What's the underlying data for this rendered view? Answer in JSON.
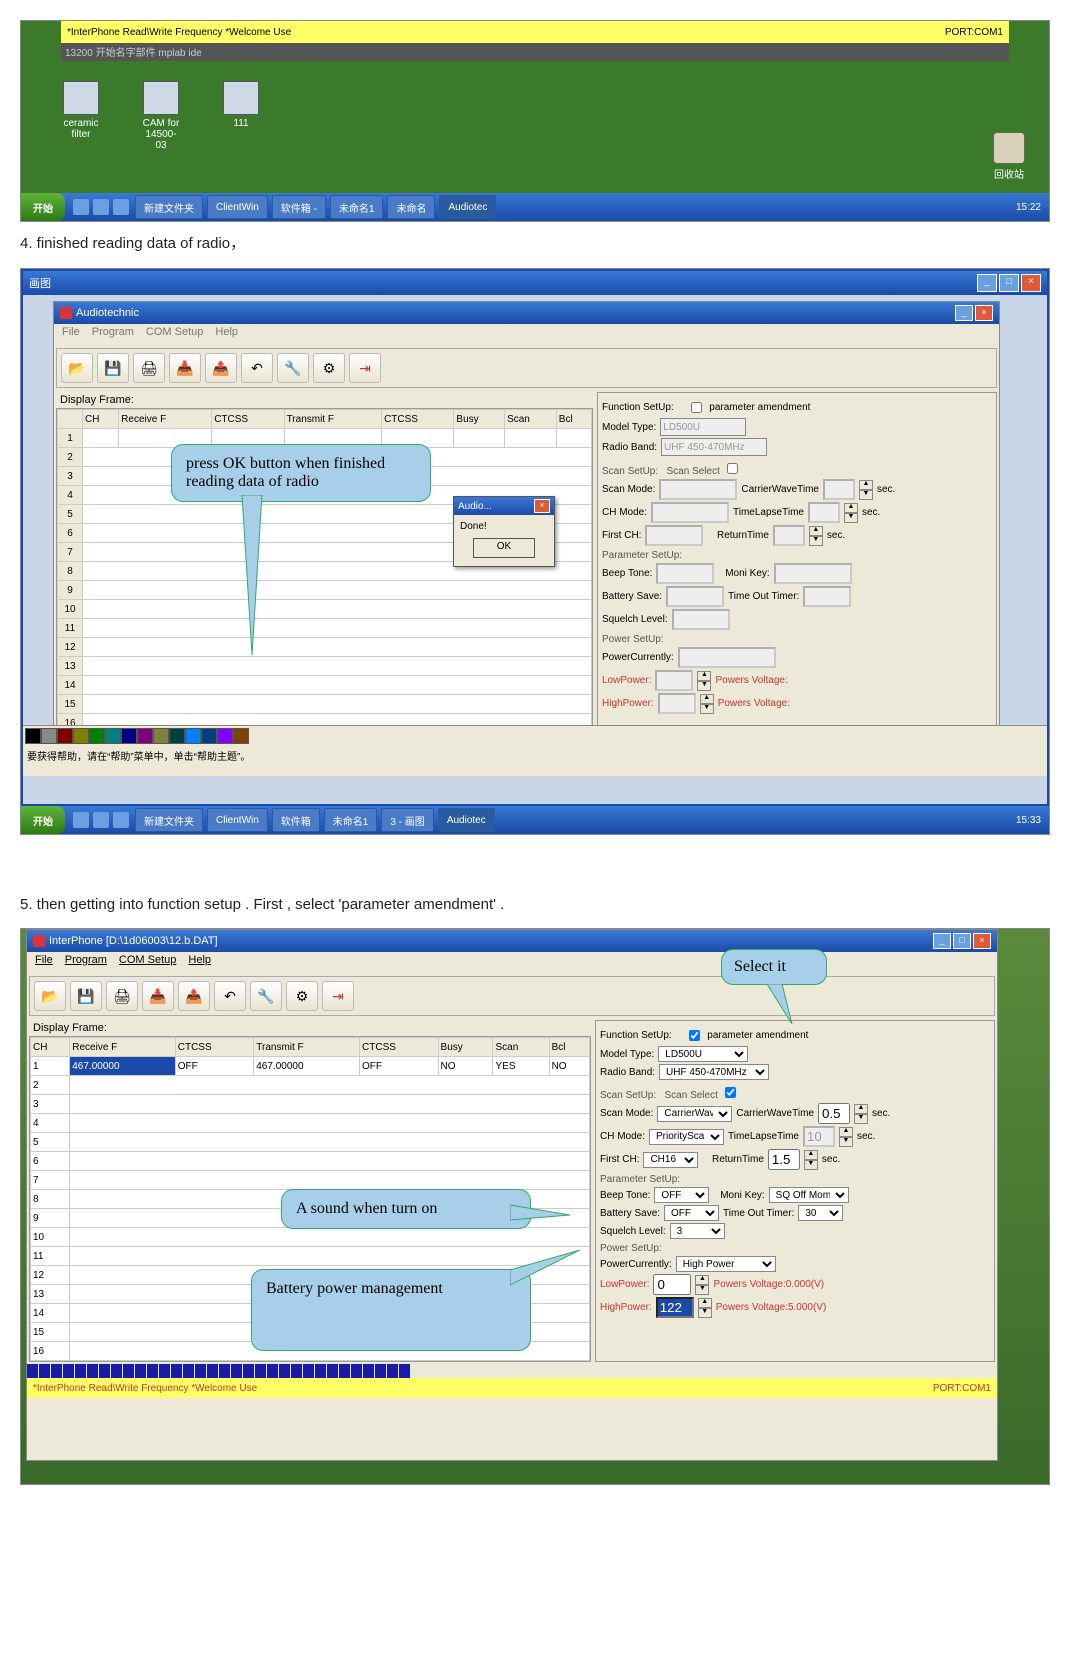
{
  "steps": {
    "s4": "4. finished  reading data of radio，",
    "s5": "5. then getting into function setup . First , select 'parameter amendment' ."
  },
  "callouts": {
    "c1": "press OK button when finished reading data of radio",
    "c2": "Select it",
    "c3": "A sound when turn on",
    "c4": "Battery power management"
  },
  "shot1": {
    "status_left": "*InterPhone Read\\Write Frequency  *Welcome Use",
    "status_right": "PORT:COM1",
    "grey": "13200   开始名字部件   mplab ide",
    "icons": [
      "ceramic filter",
      "CAM for 14500-03",
      "111"
    ],
    "trash": "回收站"
  },
  "taskbar": {
    "start": "开始",
    "items": [
      "新建文件夹",
      "ClientWin",
      "软件箱 -",
      "未命名1",
      "未命名",
      "Audiotec"
    ],
    "clock": "15:22"
  },
  "app": {
    "title": "Audiotechnic",
    "title3": "InterPhone  [D:\\1d06003\\12.b.DAT]",
    "menu": [
      "File",
      "Program",
      "COM Setup",
      "Help"
    ],
    "menu_grey": [
      "File",
      "Program",
      "COM Setup",
      "Help"
    ],
    "pane_label": "Display Frame:",
    "cols": [
      "CH",
      "Receive F",
      "CTCSS",
      "Transmit F",
      "CTCSS",
      "Busy",
      "Scan",
      "Bcl"
    ],
    "rows": [
      "1",
      "2",
      "3",
      "4",
      "5",
      "6",
      "7",
      "8",
      "9",
      "10",
      "11",
      "12",
      "13",
      "14",
      "15",
      "16"
    ],
    "s3_row1": [
      "1",
      "467.00000",
      "OFF",
      "467.00000",
      "OFF",
      "NO",
      "YES",
      "NO"
    ],
    "fn_label": "Function SetUp:",
    "param_amend": "parameter amendment",
    "model_type_lbl": "Model Type:",
    "model_type_val": "LD500U",
    "radio_band_lbl": "Radio Band:",
    "radio_band_val": "UHF 450-470MHz",
    "scan_setup": "Scan SetUp:",
    "scan_select": "Scan Select",
    "scan_mode_lbl": "Scan Mode:",
    "scan_mode_val": "CarrierWave",
    "carrier_time_lbl": "CarrierWaveTime",
    "carrier_time_val": "0.5",
    "ch_mode_lbl": "CH Mode:",
    "ch_mode_val": "PriorityScant",
    "timelapse_lbl": "TimeLapseTime",
    "timelapse_val": "10",
    "first_ch_lbl": "First CH:",
    "first_ch_val": "CH16",
    "return_lbl": "ReturnTime",
    "return_val": "1.5",
    "sec_unit": "sec.",
    "param_setup": "Parameter SetUp:",
    "beep_lbl": "Beep Tone:",
    "beep_val": "OFF",
    "moni_lbl": "Moni Key:",
    "moni_val": "SQ Off Mom.",
    "batt_lbl": "Battery Save:",
    "batt_val": "OFF",
    "tot_lbl": "Time Out Timer:",
    "tot_val": "30",
    "sq_lbl": "Squelch Level:",
    "sq_val": "3",
    "power_setup": "Power SetUp:",
    "pcur_lbl": "PowerCurrently:",
    "pcur_val": "High Power",
    "low_lbl": "LowPower:",
    "low_val": "0",
    "low_volt": "Powers Voltage:0.000(V)",
    "high_lbl": "HighPower:",
    "high_val": "122",
    "high_volt": "Powers Voltage:5.000(V)",
    "status_left": "*InterPhone Read\\Write Frequency  *Welcome Use",
    "status_right": "PORT:COM1"
  },
  "dialog": {
    "title": "Audio...",
    "msg": "Done!",
    "ok": "OK"
  },
  "paint_hint": "要获得帮助，请在“帮助”菜单中，单击“帮助主题”。",
  "taskbar2": {
    "items": [
      "新建文件夹",
      "ClientWin",
      "软件箱",
      "未命名1",
      "3 - 画图",
      "Audiotec"
    ],
    "clock": "15:33"
  }
}
